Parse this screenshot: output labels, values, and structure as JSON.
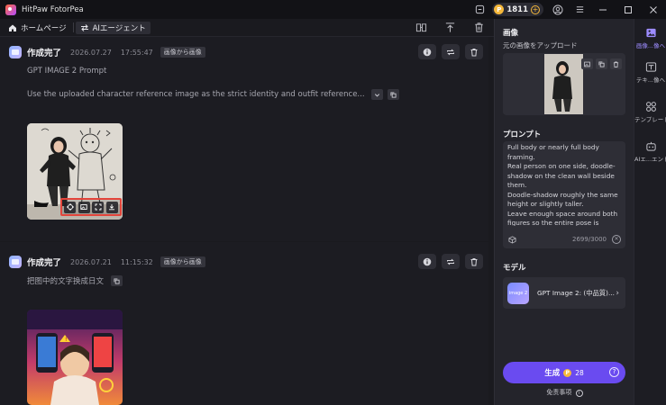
{
  "window": {
    "title": "HitPaw FotorPea",
    "credits": "1811"
  },
  "toolbar": {
    "home_label": "ホームページ",
    "agent_label": "AIエージェント"
  },
  "cards": [
    {
      "status": "作成完了",
      "date": "2026.07.27",
      "time": "17:55:47",
      "badge": "画像から画像",
      "prompt_title": "GPT IMAGE 2 Prompt",
      "prompt_preview": "Use the uploaded character reference image as the strict identity and outfit reference..."
    },
    {
      "status": "作成完了",
      "date": "2026.07.21",
      "time": "11:15:32",
      "badge": "画像から画像",
      "prompt_preview": "把图中的文字换成日文"
    }
  ],
  "panel": {
    "image_heading": "画像",
    "upload_label": "元の画像をアップロード",
    "prompt_heading": "プロンプト",
    "prompt_text": "Full body or nearly full body\nframing.\nReal person on one side, doodle-\nshadow on the clean wall beside\nthem.\nDoodle-shadow roughly the same\nheight or slightly taller.\nLeave enough space around both\nfigures so the entire pose is visible.",
    "char_count": "2699/3000",
    "model_heading": "モデル",
    "model_name": "GPT Image 2: (中品質)...",
    "model_icon_text": "image 2",
    "generate_label": "生成",
    "generate_cost": "28",
    "disclaimer": "免责事项"
  },
  "rail": [
    {
      "label": "画像...像へ"
    },
    {
      "label": "テキ...像へ"
    },
    {
      "label": "テンプレート"
    },
    {
      "label": "AIエ...エント"
    }
  ],
  "colors": {
    "accent": "#6a4bf0",
    "highlight_border": "#e3453b",
    "coin": "#f5b83b"
  }
}
